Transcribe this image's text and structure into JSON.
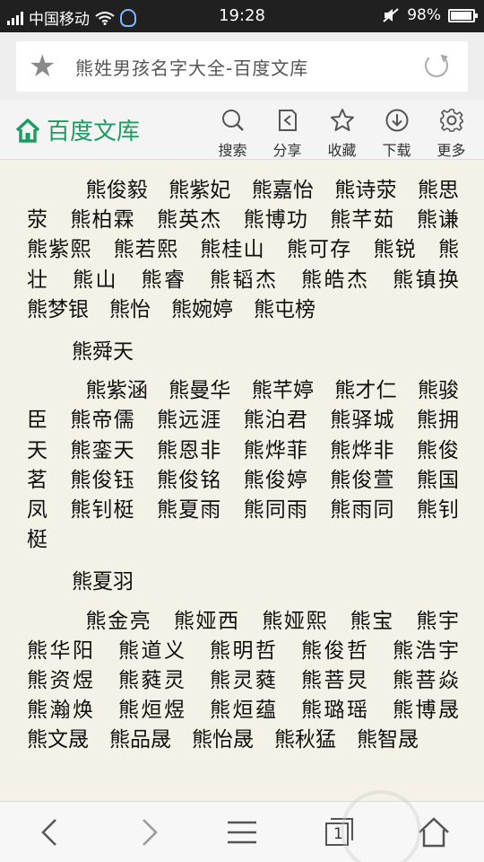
{
  "status": {
    "carrier": "中国移动",
    "time": "19:28",
    "battery": "98%"
  },
  "address": {
    "title": "熊姓男孩名字大全-百度文库"
  },
  "site": {
    "logo_text": "百度文库",
    "tools": [
      {
        "label": "搜索",
        "icon": "search-icon"
      },
      {
        "label": "分享",
        "icon": "share-icon"
      },
      {
        "label": "收藏",
        "icon": "favorite-star-icon"
      },
      {
        "label": "下载",
        "icon": "download-icon"
      },
      {
        "label": "更多",
        "icon": "gear-icon"
      }
    ]
  },
  "content": {
    "para1": "熊俊毅　熊紫妃　熊嘉怡　熊诗荥　熊思荥　熊柏霖　熊英杰　熊博功　熊芊茹　熊谦　熊紫熙　熊若熙　熊桂山　熊可存　熊锐　熊壮　熊山　熊睿　熊韬杰　熊皓杰　熊镇换　熊梦银　熊怡　熊婉婷　熊屯榜",
    "sub1": "熊舜天",
    "para2": "熊紫涵　熊曼华　熊芊婷　熊才仁　熊骏臣　熊帝儒　熊远涯　熊泊君　熊驿城　熊拥天　熊銮天　熊恩非　熊烨菲　熊烨非　熊俊茗　熊俊钰　熊俊铭　熊俊婷　熊俊萱　熊国凤　熊钊梃　熊夏雨　熊同雨　熊雨同　熊钊梃",
    "sub2": "熊夏羽",
    "para3": "熊金亮　熊娅西　熊娅熙　熊宝　熊宇　熊华阳　熊道义　熊明哲　熊俊哲　熊浩宇　熊资煜　熊蕤灵　熊灵蕤　熊菩炅　熊菩焱　熊瀚焕　熊烜煜　熊烜蕴　熊璐瑶　熊博晟　熊文晟　熊品晟　熊怡晟　熊秋猛　熊智晟"
  },
  "nav": {
    "tab_count": "1"
  },
  "colors": {
    "brand": "#1e9b63",
    "page_bg": "#f4f1e6"
  }
}
